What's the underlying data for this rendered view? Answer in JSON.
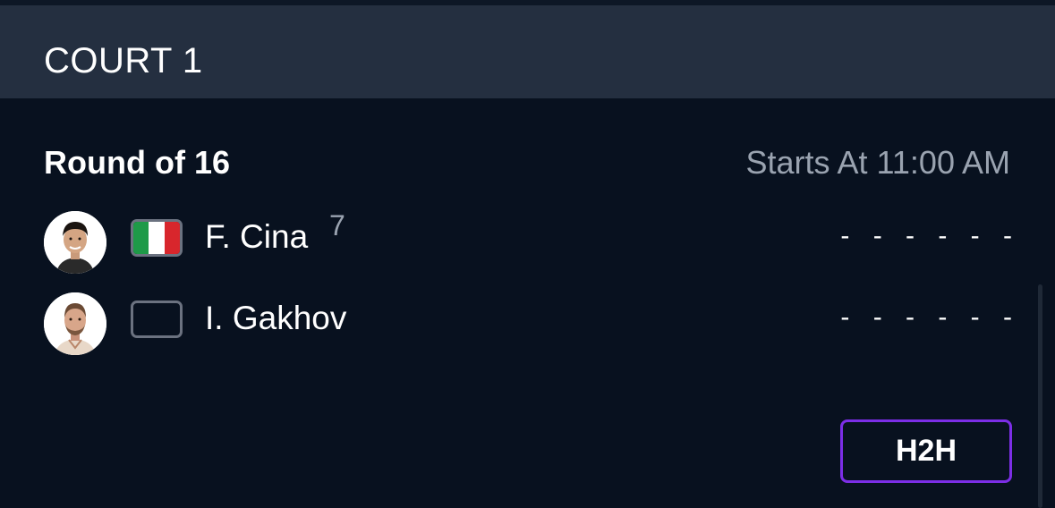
{
  "court": {
    "title": "COURT 1"
  },
  "match": {
    "round": "Round of 16",
    "start_time": "Starts At 11:00 AM"
  },
  "players": [
    {
      "name": "F. Cina",
      "seed": "7",
      "flag": "italy",
      "flag_colors": [
        "#1e9a48",
        "#ffffff",
        "#d8262c"
      ],
      "score": "- - - - - -"
    },
    {
      "name": "I. Gakhov",
      "seed": "",
      "flag": "none",
      "score": "- - - - - -"
    }
  ],
  "actions": {
    "h2h_label": "H2H"
  },
  "colors": {
    "background": "#08111f",
    "header": "#242f40",
    "accent": "#7c2ee6",
    "muted_text": "#9aa3b0"
  }
}
